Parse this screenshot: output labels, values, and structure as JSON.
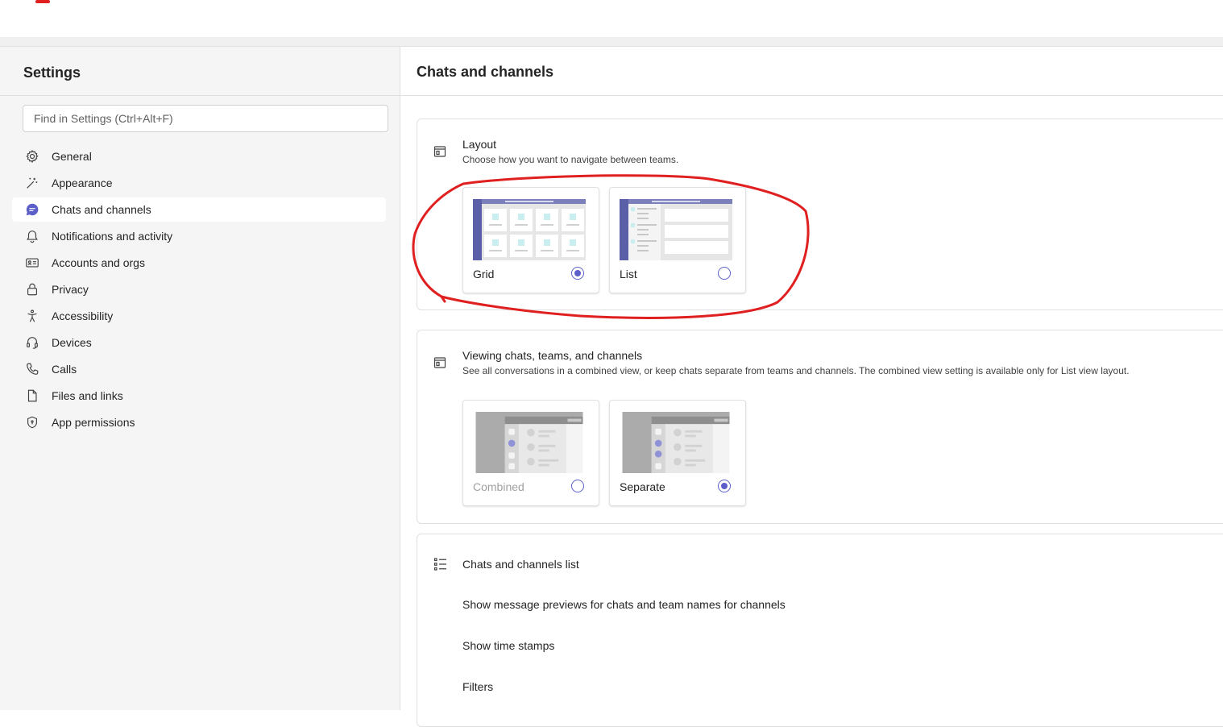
{
  "sidebar": {
    "title": "Settings",
    "search_placeholder": "Find in Settings (Ctrl+Alt+F)",
    "items": [
      {
        "label": "General",
        "icon": "gear-icon",
        "active": false
      },
      {
        "label": "Appearance",
        "icon": "magic-wand-icon",
        "active": false
      },
      {
        "label": "Chats and channels",
        "icon": "chat-icon",
        "active": true
      },
      {
        "label": "Notifications and activity",
        "icon": "bell-icon",
        "active": false
      },
      {
        "label": "Accounts and orgs",
        "icon": "id-card-icon",
        "active": false
      },
      {
        "label": "Privacy",
        "icon": "lock-icon",
        "active": false
      },
      {
        "label": "Accessibility",
        "icon": "accessibility-icon",
        "active": false
      },
      {
        "label": "Devices",
        "icon": "headset-icon",
        "active": false
      },
      {
        "label": "Calls",
        "icon": "phone-icon",
        "active": false
      },
      {
        "label": "Files and links",
        "icon": "document-icon",
        "active": false
      },
      {
        "label": "App permissions",
        "icon": "shield-icon",
        "active": false
      }
    ]
  },
  "main": {
    "heading": "Chats and channels",
    "layout": {
      "title": "Layout",
      "description": "Choose how you want to navigate between teams.",
      "options": [
        {
          "label": "Grid",
          "selected": true
        },
        {
          "label": "List",
          "selected": false
        }
      ]
    },
    "viewing": {
      "title": "Viewing chats, teams, and channels",
      "description": "See all conversations in a combined view, or keep chats separate from teams and channels. The combined view setting is available only for List view layout.",
      "options": [
        {
          "label": "Combined",
          "selected": false,
          "disabled": true
        },
        {
          "label": "Separate",
          "selected": true,
          "disabled": false
        }
      ]
    },
    "list_section": {
      "title": "Chats and channels list",
      "rows": [
        "Show message previews for chats and team names for channels",
        "Show time stamps",
        "Filters"
      ]
    }
  },
  "colors": {
    "accent": "#5b5fc7",
    "annotation": "#e02020",
    "sidebar_bg": "#f5f5f5"
  }
}
